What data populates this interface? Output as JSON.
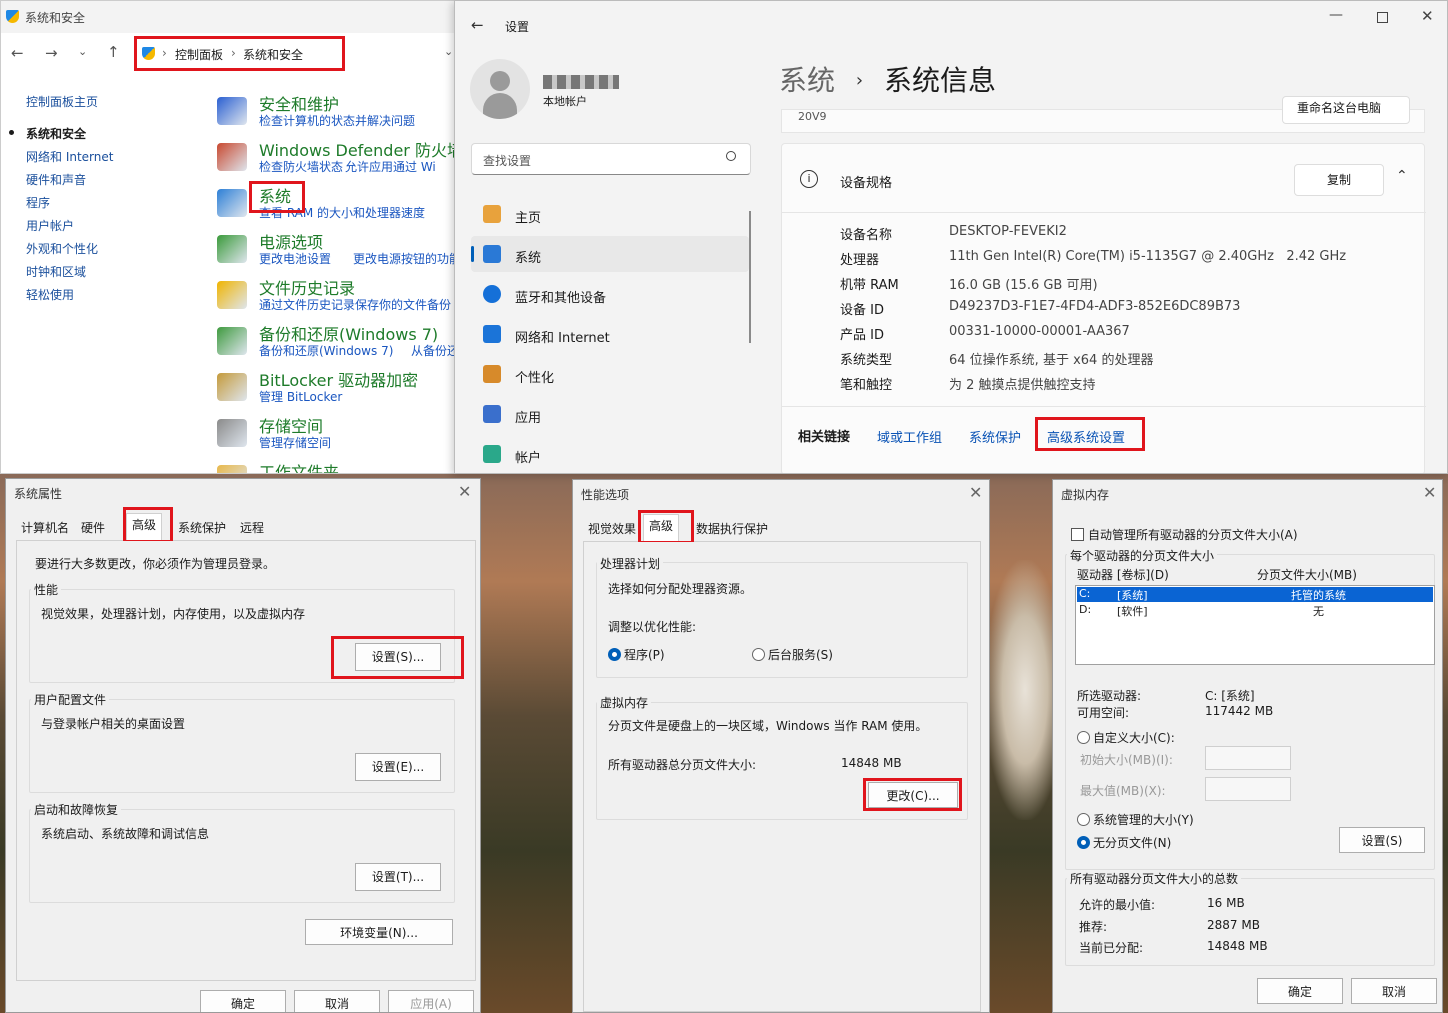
{
  "cp": {
    "title": "系统和安全",
    "bc1": "控制面板",
    "bc2": "系统和安全",
    "nav": [
      "控制面板主页",
      "系统和安全",
      "网络和 Internet",
      "硬件和声音",
      "程序",
      "用户帐户",
      "外观和个性化",
      "时钟和区域",
      "轻松使用"
    ],
    "cats": [
      {
        "t": "安全和维护",
        "l": [
          "检查计算机的状态并解决问题"
        ]
      },
      {
        "t": "Windows Defender 防火墙",
        "l": [
          "检查防火墙状态",
          "允许应用通过 Wi"
        ]
      },
      {
        "t": "系统",
        "l": [
          "查看 RAM 的大小和处理器速度"
        ]
      },
      {
        "t": "电源选项",
        "l": [
          "更改电池设置",
          "更改电源按钮的功能"
        ]
      },
      {
        "t": "文件历史记录",
        "l": [
          "通过文件历史记录保存你的文件备份"
        ]
      },
      {
        "t": "备份和还原(Windows 7)",
        "l": [
          "备份和还原(Windows 7)",
          "从备份还"
        ]
      },
      {
        "t": "BitLocker 驱动器加密",
        "l": [
          "管理 BitLocker"
        ]
      },
      {
        "t": "存储空间",
        "l": [
          "管理存储空间"
        ]
      },
      {
        "t": "工作文件夹",
        "l": []
      }
    ]
  },
  "st": {
    "title": "设置",
    "account": "本地帐户",
    "search_ph": "查找设置",
    "nav": [
      "主页",
      "系统",
      "蓝牙和其他设备",
      "网络和 Internet",
      "个性化",
      "应用",
      "帐户"
    ],
    "bc1": "系统",
    "bc2": "系统信息",
    "ver": "20V9",
    "rename": "重命名这台电脑",
    "spec_title": "设备规格",
    "copy": "复制",
    "specs": [
      [
        "设备名称",
        "DESKTOP-FEVEKI2"
      ],
      [
        "处理器",
        "11th Gen Intel(R) Core(TM) i5-1135G7 @ 2.40GHz   2.42 GHz"
      ],
      [
        "机带 RAM",
        "16.0 GB (15.6 GB 可用)"
      ],
      [
        "设备 ID",
        "D49237D3-F1E7-4FD4-ADF3-852E6DC89B73"
      ],
      [
        "产品 ID",
        "00331-10000-00001-AA367"
      ],
      [
        "系统类型",
        "64 位操作系统, 基于 x64 的处理器"
      ],
      [
        "笔和触控",
        "为 2 触摸点提供触控支持"
      ]
    ],
    "rel": "相关链接",
    "links": [
      "域或工作组",
      "系统保护",
      "高级系统设置"
    ]
  },
  "sp": {
    "title": "系统属性",
    "tabs": [
      "计算机名",
      "硬件",
      "高级",
      "系统保护",
      "远程"
    ],
    "note": "要进行大多数更改，你必须作为管理员登录。",
    "perf": "性能",
    "perf_d": "视觉效果，处理器计划，内存使用，以及虚拟内存",
    "set_s": "设置(S)...",
    "prof": "用户配置文件",
    "prof_d": "与登录帐户相关的桌面设置",
    "set_e": "设置(E)...",
    "boot": "启动和故障恢复",
    "boot_d": "系统启动、系统故障和调试信息",
    "set_t": "设置(T)...",
    "env": "环境变量(N)...",
    "ok": "确定",
    "cancel": "取消",
    "apply": "应用(A)"
  },
  "po": {
    "title": "性能选项",
    "tabs": [
      "视觉效果",
      "高级",
      "数据执行保护"
    ],
    "ps": "处理器计划",
    "ps_d": "选择如何分配处理器资源。",
    "opt": "调整以优化性能:",
    "prog": "程序(P)",
    "bg": "后台服务(S)",
    "vm": "虚拟内存",
    "vm_d": "分页文件是硬盘上的一块区域，Windows 当作 RAM 使用。",
    "total": "所有驱动器总分页文件大小:",
    "total_v": "14848 MB",
    "change": "更改(C)..."
  },
  "vm": {
    "title": "虚拟内存",
    "auto": "自动管理所有驱动器的分页文件大小(A)",
    "each": "每个驱动器的分页文件大小",
    "col1": "驱动器 [卷标](D)",
    "col2": "分页文件大小(MB)",
    "rows": [
      [
        "C:",
        "[系统]",
        "托管的系统"
      ],
      [
        "D:",
        "[软件]",
        "无"
      ]
    ],
    "sel": "所选驱动器:",
    "sel_v": "C:  [系统]",
    "free": "可用空间:",
    "free_v": "117442 MB",
    "custom": "自定义大小(C):",
    "init": "初始大小(MB)(I):",
    "max": "最大值(MB)(X):",
    "managed": "系统管理的大小(Y)",
    "none": "无分页文件(N)",
    "set": "设置(S)",
    "tot": "所有驱动器分页文件大小的总数",
    "min": "允许的最小值:",
    "min_v": "16 MB",
    "rec": "推荐:",
    "rec_v": "2887 MB",
    "cur": "当前已分配:",
    "cur_v": "14848 MB",
    "ok": "确定",
    "cancel": "取消"
  }
}
